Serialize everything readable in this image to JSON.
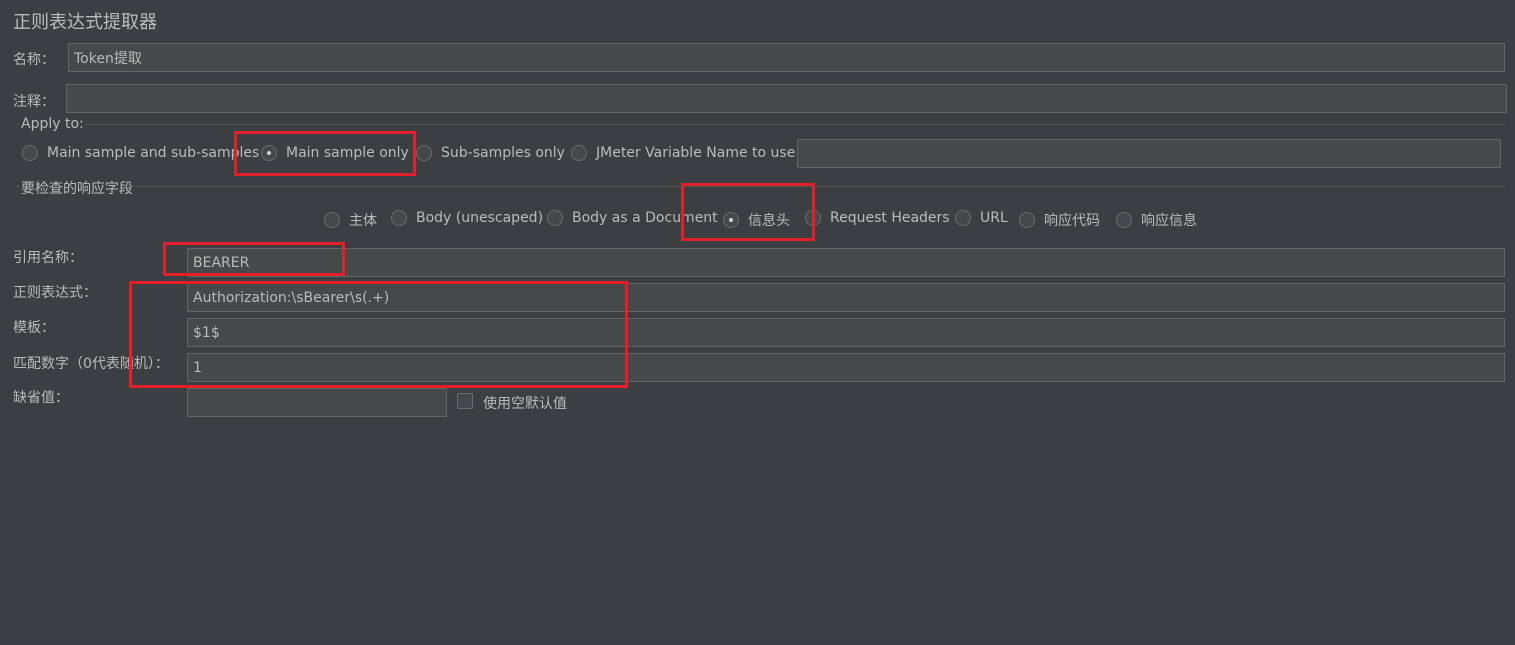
{
  "panel": {
    "title": "正则表达式提取器"
  },
  "name_row": {
    "label": "名称：",
    "value": "Token提取"
  },
  "comment_row": {
    "label": "注释：",
    "value": ""
  },
  "apply_to": {
    "title": "Apply to:",
    "options": [
      "Main sample and sub-samples",
      "Main sample only",
      "Sub-samples only",
      "JMeter Variable Name to use"
    ],
    "selected": "Main sample only",
    "variable_value": ""
  },
  "field_to_check": {
    "title": "要检查的响应字段",
    "options": [
      "主体",
      "Body (unescaped)",
      "Body as a Document",
      "信息头",
      "Request Headers",
      "URL",
      "响应代码",
      "响应信息"
    ],
    "selected": "信息头"
  },
  "settings": {
    "ref_name_label": "引用名称：",
    "ref_name_value": "BEARER",
    "regex_label": "正则表达式：",
    "regex_value": "Authorization:\\sBearer\\s(.+)",
    "template_label": "模板：",
    "template_value": "$1$",
    "match_no_label": "匹配数字（0代表随机）：",
    "match_no_value": "1",
    "default_label": "缺省值：",
    "default_value": "",
    "use_empty_default_label": "使用空默认值",
    "use_empty_default_checked": false
  },
  "colors": {
    "background": "#3c3f41",
    "field_bg": "#45494a",
    "text": "#bbbbbb",
    "highlight_box": "#e3202a"
  }
}
